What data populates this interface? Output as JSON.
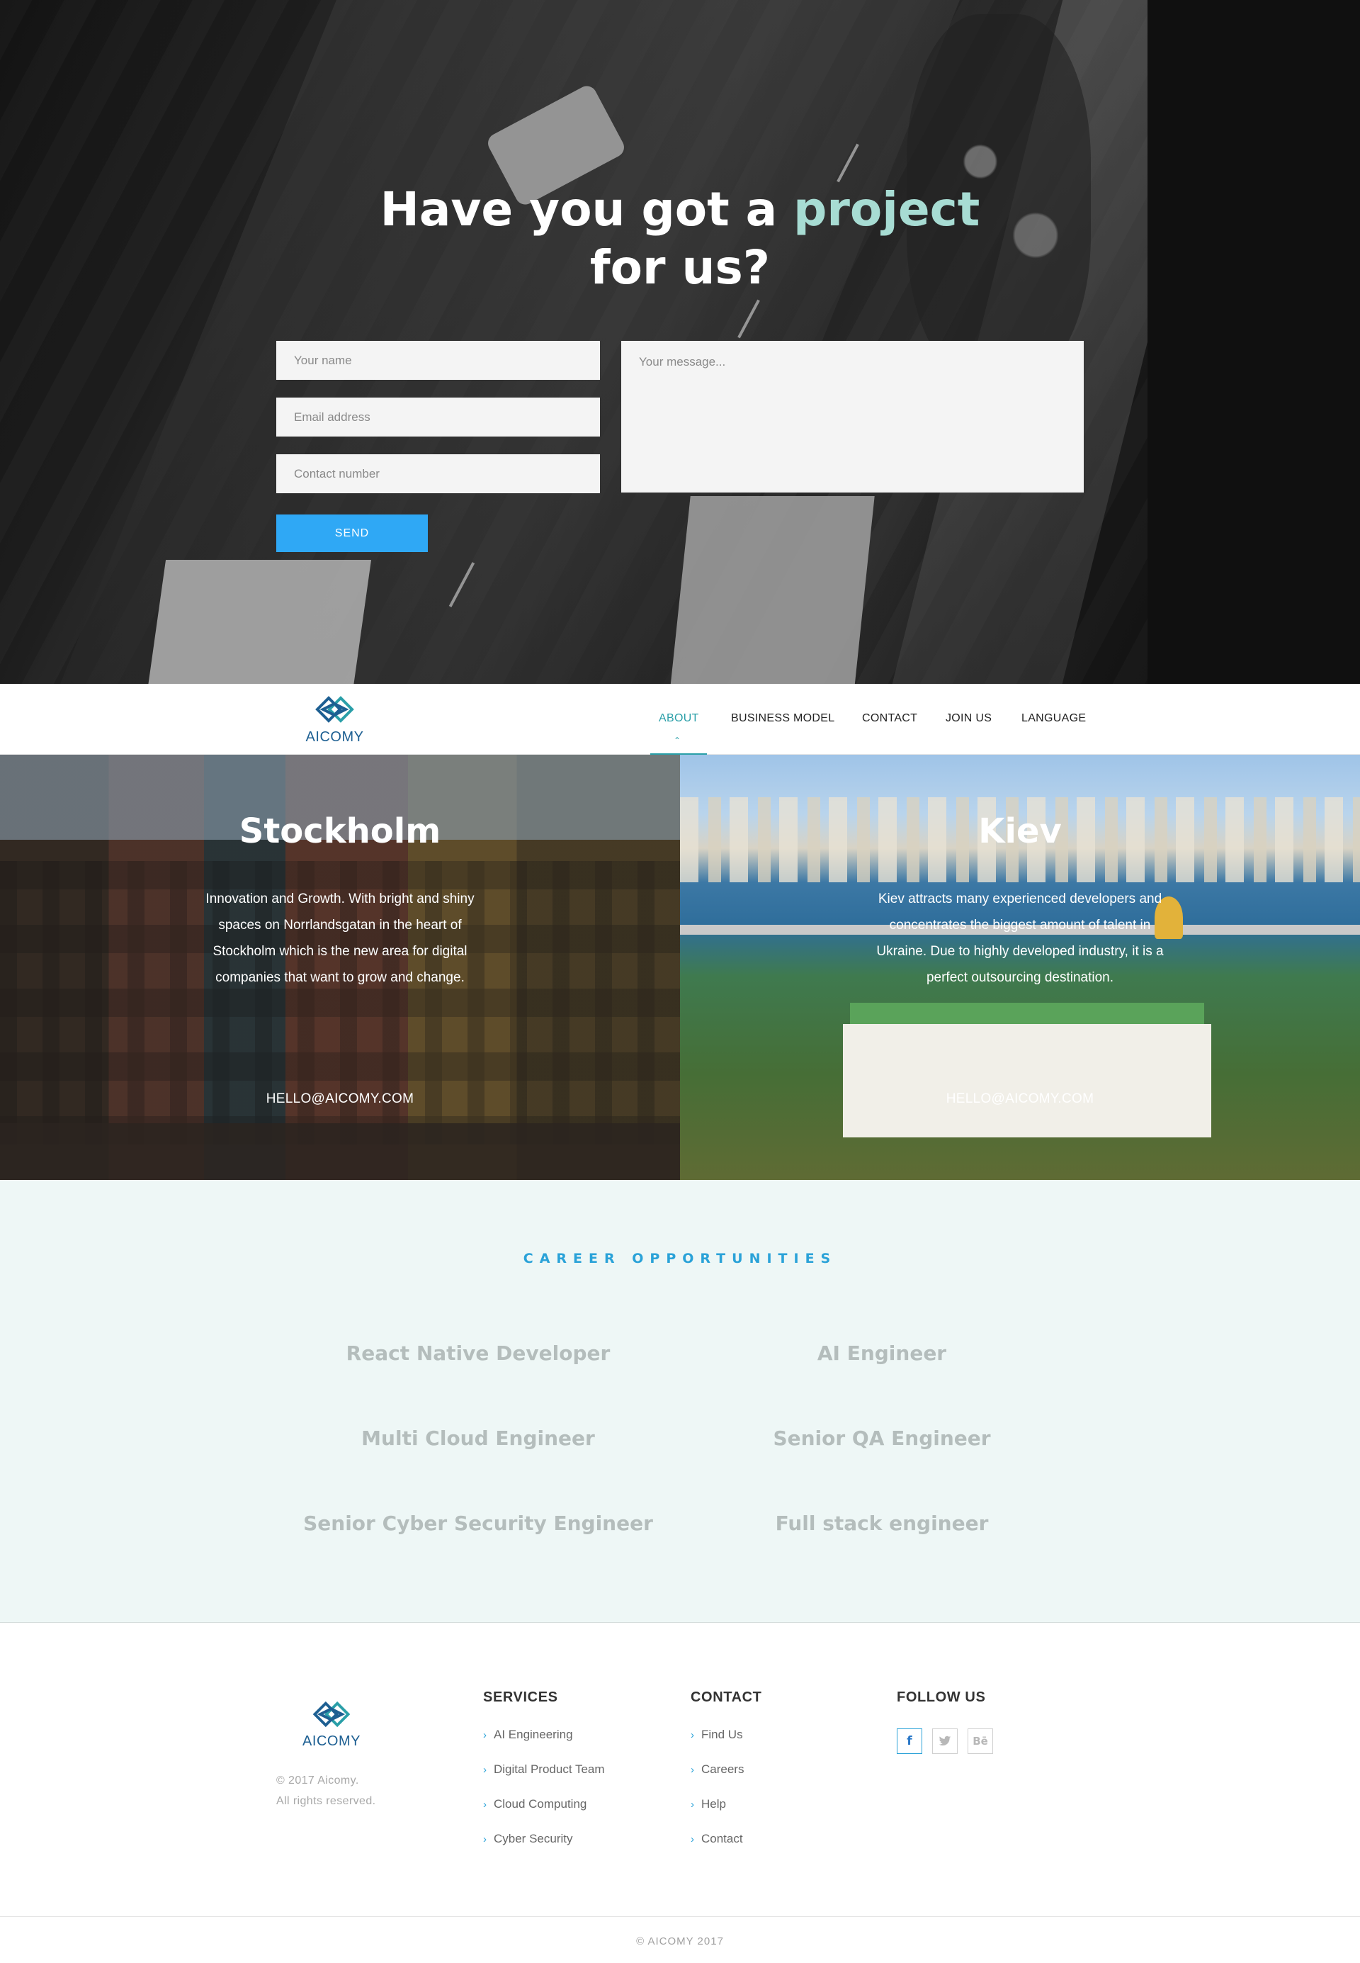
{
  "hero": {
    "title_part1": "Have you got a ",
    "title_accent": "project",
    "title_part2": "for us?",
    "name_placeholder": "Your name",
    "email_placeholder": "Email address",
    "phone_placeholder": "Contact number",
    "message_placeholder": "Your message...",
    "send_label": "SEND"
  },
  "nav": {
    "logo_text": "AICOMY",
    "items": [
      "ABOUT",
      "BUSINESS MODEL",
      "CONTACT",
      "JOIN US",
      "LANGUAGE"
    ],
    "active": "ABOUT"
  },
  "cities": [
    {
      "name": "Stockholm",
      "description": "Innovation and Growth. With bright and shiny spaces on Norrlandsgatan in the heart of Stockholm which is the new area for digital companies that want to grow and change.",
      "email": "HELLO@AICOMY.COM"
    },
    {
      "name": "Kiev",
      "description": "Kiev attracts many experienced developers and concentrates the biggest amount of talent in Ukraine. Due to highly developed industry, it is a perfect outsourcing destination.",
      "email": "HELLO@AICOMY.COM"
    }
  ],
  "careers": {
    "heading": "CAREER OPPORTUNITIES",
    "jobs": [
      "React Native Developer",
      "AI Engineer",
      "Multi Cloud Engineer",
      "Senior QA Engineer",
      "Senior Cyber Security Engineer",
      "Full stack engineer"
    ]
  },
  "footer": {
    "logo_text": "AICOMY",
    "copyright_line1": "© 2017 Aicomy.",
    "copyright_line2": "All rights reserved.",
    "services_title": "SERVICES",
    "services": [
      "AI Engineering",
      "Digital Product Team",
      "Cloud Computing",
      "Cyber Security"
    ],
    "contact_title": "CONTACT",
    "contact_links": [
      "Find Us",
      "Careers",
      "Help",
      "Contact"
    ],
    "follow_title": "FOLLOW US",
    "social": [
      "facebook-icon",
      "twitter-icon",
      "behance-icon"
    ],
    "bottom_copyright": "© AICOMY 2017"
  },
  "colors": {
    "accent_teal": "#a7dcd3",
    "send_blue": "#2fa8f5",
    "nav_active": "#2a9fa8",
    "careers_heading": "#2aa2d8",
    "careers_bg": "#eef7f6",
    "logo_blue": "#1d5f92"
  }
}
